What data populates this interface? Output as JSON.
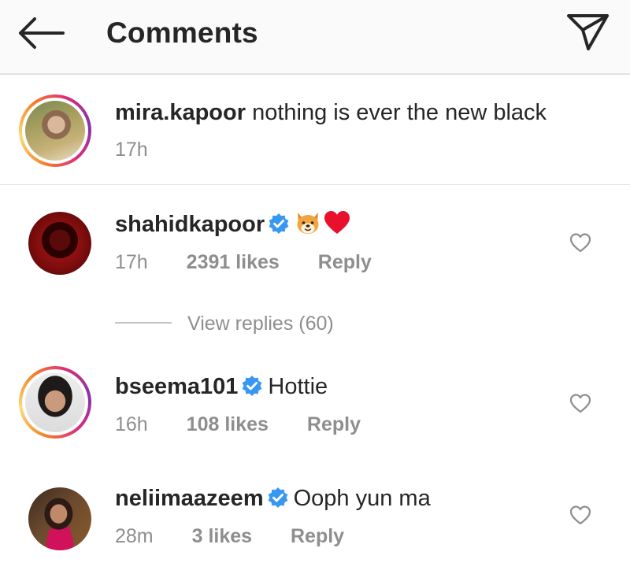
{
  "header": {
    "title": "Comments",
    "back_icon": "arrow-left-icon",
    "send_icon": "paper-plane-icon"
  },
  "caption": {
    "username": "mira.kapoor",
    "text": "nothing is ever the new black",
    "time": "17h"
  },
  "comments": [
    {
      "username": "shahidkapoor",
      "verified": true,
      "text": "",
      "emojis": [
        "dog-face-emoji",
        "red-heart-emoji"
      ],
      "time": "17h",
      "likes": "2391 likes",
      "reply": "Reply",
      "view_replies": "View replies (60)"
    },
    {
      "username": "bseema101",
      "verified": true,
      "text": "Hottie",
      "time": "16h",
      "likes": "108 likes",
      "reply": "Reply"
    },
    {
      "username": "neliimaazeem",
      "verified": true,
      "text": "Ooph yun ma",
      "time": "28m",
      "likes": "3 likes",
      "reply": "Reply"
    }
  ],
  "colors": {
    "text_primary": "#262626",
    "text_secondary": "#8e8e8e",
    "verified_blue": "#3897f0",
    "heart_red": "#e8102d",
    "header_bg": "#fafafa"
  }
}
